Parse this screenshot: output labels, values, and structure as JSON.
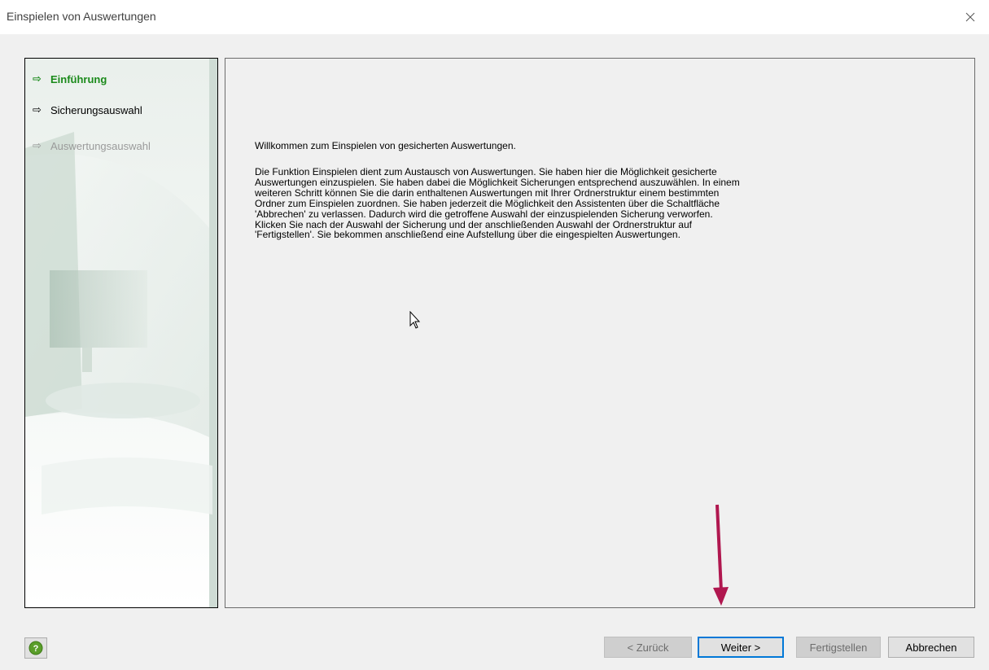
{
  "window": {
    "title": "Einspielen von Auswertungen",
    "close_icon": "close-icon"
  },
  "steps": [
    {
      "label": "Einführung",
      "state": "active",
      "icon": "arrow-right-icon"
    },
    {
      "label": "Sicherungsauswahl",
      "state": "done",
      "icon": "arrow-right-icon"
    },
    {
      "label": "Auswertungsauswahl",
      "state": "disabled",
      "icon": "arrow-right-icon"
    }
  ],
  "content": {
    "welcome": "Willkommen zum Einspielen von gesicherten Auswertungen.",
    "lines": [
      "Die Funktion Einspielen dient zum Austausch von Auswertungen. Sie haben hier die Möglichkeit gesicherte",
      "Auswertungen einzuspielen. Sie haben dabei die Möglichkeit Sicherungen entsprechend auszuwählen. In einem",
      "weiteren Schritt können Sie die darin enthaltenen Auswertungen mit Ihrer Ordnerstruktur einem bestimmten",
      "Ordner zum Einspielen zuordnen. Sie haben jederzeit die Möglichkeit den Assistenten über die Schaltfläche",
      "'Abbrechen' zu verlassen. Dadurch wird die getroffene Auswahl der einzuspielenden Sicherung verworfen.",
      "Klicken Sie nach der Auswahl der Sicherung und der anschließenden Auswahl der Ordnerstruktur auf",
      "'Fertigstellen'. Sie bekommen anschließend eine Aufstellung über die eingespielten Auswertungen."
    ]
  },
  "buttons": {
    "help_icon": "help-icon",
    "back": "< Zurück",
    "next": "Weiter >",
    "finish": "Fertigstellen",
    "cancel": "Abbrechen"
  },
  "colors": {
    "active_step": "#1a8a1a",
    "disabled_step": "#9a9a9a",
    "annotation_arrow": "#b0174f",
    "focus_border": "#0078d7"
  }
}
